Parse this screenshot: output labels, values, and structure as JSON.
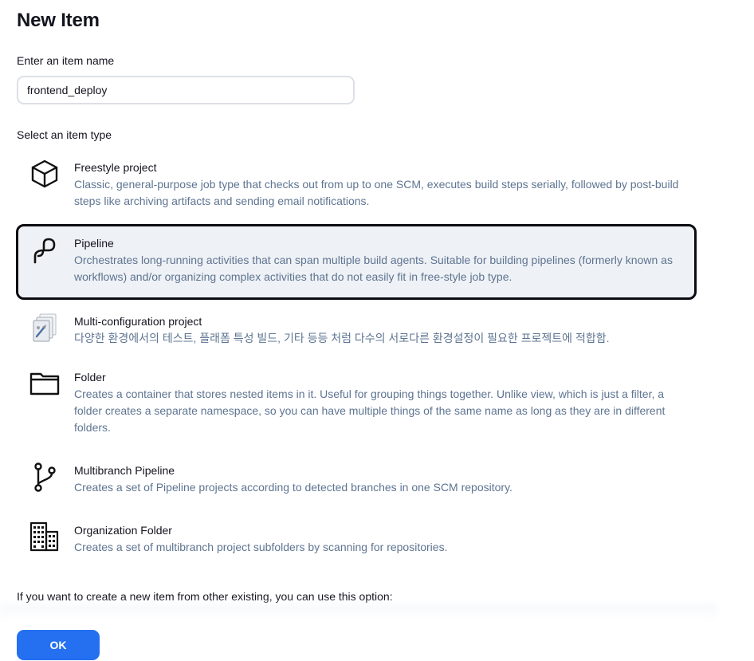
{
  "page": {
    "title": "New Item"
  },
  "item_name": {
    "label": "Enter an item name",
    "value": "frontend_deploy"
  },
  "item_type": {
    "label": "Select an item type",
    "selected": "Pipeline",
    "options": [
      {
        "icon": "freestyle-cube-icon",
        "name": "Freestyle project",
        "description": "Classic, general-purpose job type that checks out from up to one SCM, executes build steps serially, followed by post-build steps like archiving artifacts and sending email notifications."
      },
      {
        "icon": "pipeline-icon",
        "name": "Pipeline",
        "description": "Orchestrates long-running activities that can span multiple build agents. Suitable for building pipelines (formerly known as workflows) and/or organizing complex activities that do not easily fit in free-style job type."
      },
      {
        "icon": "multi-configuration-icon",
        "name": "Multi-configuration project",
        "description": "다양한 환경에서의 테스트, 플래폼 특성 빌드, 기타 등등 처럼 다수의 서로다른 환경설정이 필요한 프로젝트에 적합함."
      },
      {
        "icon": "folder-icon",
        "name": "Folder",
        "description": "Creates a container that stores nested items in it. Useful for grouping things together. Unlike view, which is just a filter, a folder creates a separate namespace, so you can have multiple things of the same name as long as they are in different folders."
      },
      {
        "icon": "branch-icon",
        "name": "Multibranch Pipeline",
        "description": "Creates a set of Pipeline projects according to detected branches in one SCM repository."
      },
      {
        "icon": "building-icon",
        "name": "Organization Folder",
        "description": "Creates a set of multibranch project subfolders by scanning for repositories."
      }
    ]
  },
  "copy": {
    "label": "If you want to create a new item from other existing, you can use this option:"
  },
  "actions": {
    "ok_label": "OK"
  },
  "colors": {
    "accent": "#2470f0",
    "description_text": "#5e7491",
    "selected_background": "#eef1f5",
    "selected_border": "#0b0b10"
  }
}
